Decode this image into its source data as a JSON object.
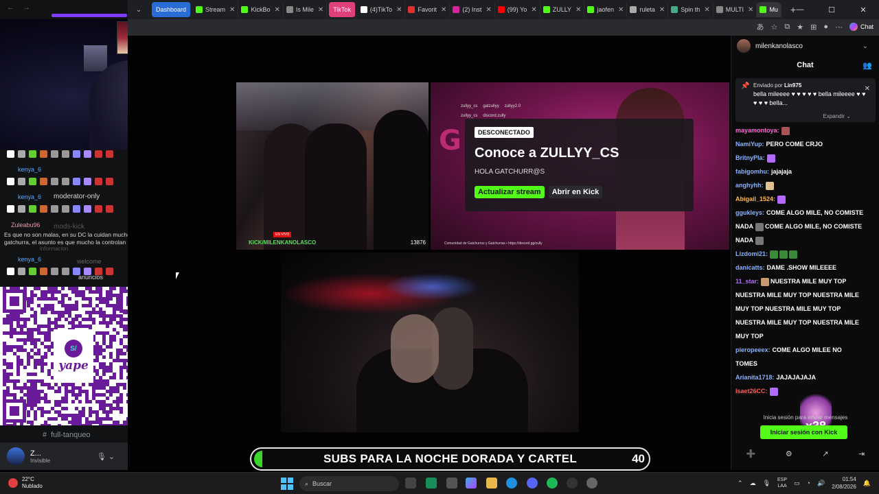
{
  "browser": {
    "tabs": [
      {
        "label": "Dashboard",
        "color": "#2a6cd6",
        "group": true
      },
      {
        "label": "Stream",
        "icon": "kick-icon"
      },
      {
        "label": "KickBo",
        "icon": "kick-icon"
      },
      {
        "label": "Is Mile",
        "icon": "globe-icon"
      },
      {
        "label": "TikTok",
        "color": "#e0407a",
        "group": true
      },
      {
        "label": "(4)TikTo",
        "icon": "tiktok-icon"
      },
      {
        "label": "Favorit",
        "icon": "red-icon"
      },
      {
        "label": "(2) Inst",
        "icon": "instagram-icon"
      },
      {
        "label": "(99) Yo",
        "icon": "youtube-icon"
      },
      {
        "label": "ZULLY",
        "icon": "kick-icon"
      },
      {
        "label": "jaofen",
        "icon": "kick-icon"
      },
      {
        "label": "ruleta",
        "icon": "search-icon"
      },
      {
        "label": "Spin th",
        "icon": "spin-icon"
      },
      {
        "label": "MULTI",
        "icon": "globe-icon"
      },
      {
        "label": "Mu",
        "icon": "mk-icon",
        "active": true
      }
    ],
    "copilot_label": "Chat"
  },
  "left_panel": {
    "usernames": [
      "kenya_6",
      "kenya_6",
      "Zuleabu96",
      "kenya_6"
    ],
    "overlay_text": {
      "moderator": "moderator-only",
      "mods_kick": "mods-kick",
      "informacion": "informacion",
      "welcome": "welcome",
      "anuncios": "anuncios",
      "message": "Es que no son malas, en su DC la cuidan mucho demasiado y eso que no soy ni gatchurra, el asunto es que mucho la controlan"
    },
    "channel_bottom": "full-tanqueo",
    "user_name": "Z...",
    "user_status": "Invisible"
  },
  "qr": {
    "brand": "yape",
    "badge": "S/"
  },
  "video_left": {
    "watermark": "KICK/MILENKANOLASCO",
    "counter": "13876",
    "live": "EN VIVO"
  },
  "video_right": {
    "handles_top": [
      "zullyy_cs",
      "gatzullyy",
      "zullyy2.0"
    ],
    "handles_bottom": [
      "zullyy_cs",
      "discord.zully"
    ],
    "community": "Comunidad de Gatchurros y Gatchurras • https://discord.gg/zully",
    "offline_badge": "DESCONECTADO",
    "title": "Conoce a ZULLYY_CS",
    "subtitle": "HOLA GATCHURR@S",
    "btn_refresh": "Actualizar stream",
    "btn_open": "Abrir en Kick"
  },
  "ticker": {
    "text": "SUBS PARA LA NOCHE DORADA Y CARTEL",
    "count": "40"
  },
  "chat": {
    "channel": "milenkanolasco",
    "title": "Chat",
    "pinned": {
      "sent_by_prefix": "Enviado por",
      "sent_by_user": "Lin975",
      "message": "bella mileeee ♥ ♥ ♥ ♥ ♥ bella mileeee ♥ ♥ ♥ ♥ ♥ bella...",
      "expand": "Expandir"
    },
    "messages": [
      {
        "user": "mayamontoya:",
        "color": "#ff6ad5",
        "text": "",
        "emotes": [
          "#a55"
        ]
      },
      {
        "user": "NamiYup:",
        "color": "#8ab4ff",
        "text": "PERO COME CRJO",
        "emotes": []
      },
      {
        "user": "BritnyPla:",
        "color": "#8ab4ff",
        "text": "",
        "emotes": [
          "#b36bff"
        ]
      },
      {
        "user": "fabigomhu:",
        "color": "#8ab4ff",
        "text": "jajajaja",
        "emotes": []
      },
      {
        "user": "anghyhh:",
        "color": "#8ab4ff",
        "text": "",
        "emotes": [
          "#e0c090"
        ]
      },
      {
        "user": "Abigail_1524:",
        "color": "#ffb84d",
        "text": "",
        "emotes": [
          "#b36bff"
        ]
      },
      {
        "user": "ggukleys:",
        "color": "#8ab4ff",
        "text": "COME ALGO MILE, NO COMISTE",
        "emotes": []
      },
      {
        "user": "NADA",
        "color": "#ffffff",
        "text": "COME ALGO MILE, NO COMISTE",
        "emotes": [
          "#777"
        ]
      },
      {
        "user": "NADA",
        "color": "#ffffff",
        "text": "",
        "emotes": [
          "#777"
        ]
      },
      {
        "user": "Lizdomi21:",
        "color": "#8ab4ff",
        "text": "",
        "emotes": [
          "#3a8a3a",
          "#3a8a3a",
          "#3a8a3a"
        ]
      },
      {
        "user": "danicatts:",
        "color": "#8ab4ff",
        "text": "DAME .SHOW MILEEEE",
        "emotes": []
      },
      {
        "user": "11_star:",
        "color": "#b36bff",
        "text": "NUESTRA MILE MUY TOP",
        "emotes": [
          "#c89a70"
        ]
      },
      {
        "user": "",
        "color": "#fff",
        "text": "NUESTRA MILE MUY TOP NUESTRA MILE",
        "emotes": []
      },
      {
        "user": "",
        "color": "#fff",
        "text": "MUY TOP NUESTRA MILE MUY TOP",
        "emotes": []
      },
      {
        "user": "",
        "color": "#fff",
        "text": "NUESTRA MILE MUY TOP NUESTRA MILE",
        "emotes": []
      },
      {
        "user": "",
        "color": "#fff",
        "text": "MUY TOP",
        "emotes": []
      },
      {
        "user": "pieropeeex:",
        "color": "#8ab4ff",
        "text": "COME ALGO MILEE NO",
        "emotes": []
      },
      {
        "user": "",
        "color": "#fff",
        "text": "TOMES",
        "emotes": []
      },
      {
        "user": "Arianita1718:",
        "color": "#8ab4ff",
        "text": "JAJAJAJAJA",
        "emotes": []
      },
      {
        "user": "Isaet26CC:",
        "color": "#ff5a5a",
        "text": "",
        "emotes": [
          "#b36bff"
        ]
      }
    ],
    "gift_count": "x38",
    "footer": "Inicia sesión para enviar mensajes",
    "login_button": "Iniciar sesión con Kick"
  },
  "taskbar": {
    "temp": "22°C",
    "weather": "Nublado",
    "search": "Buscar",
    "lang1": "ESP",
    "lang2": "LAA",
    "time": "01:54",
    "date": "2/08/2026"
  }
}
